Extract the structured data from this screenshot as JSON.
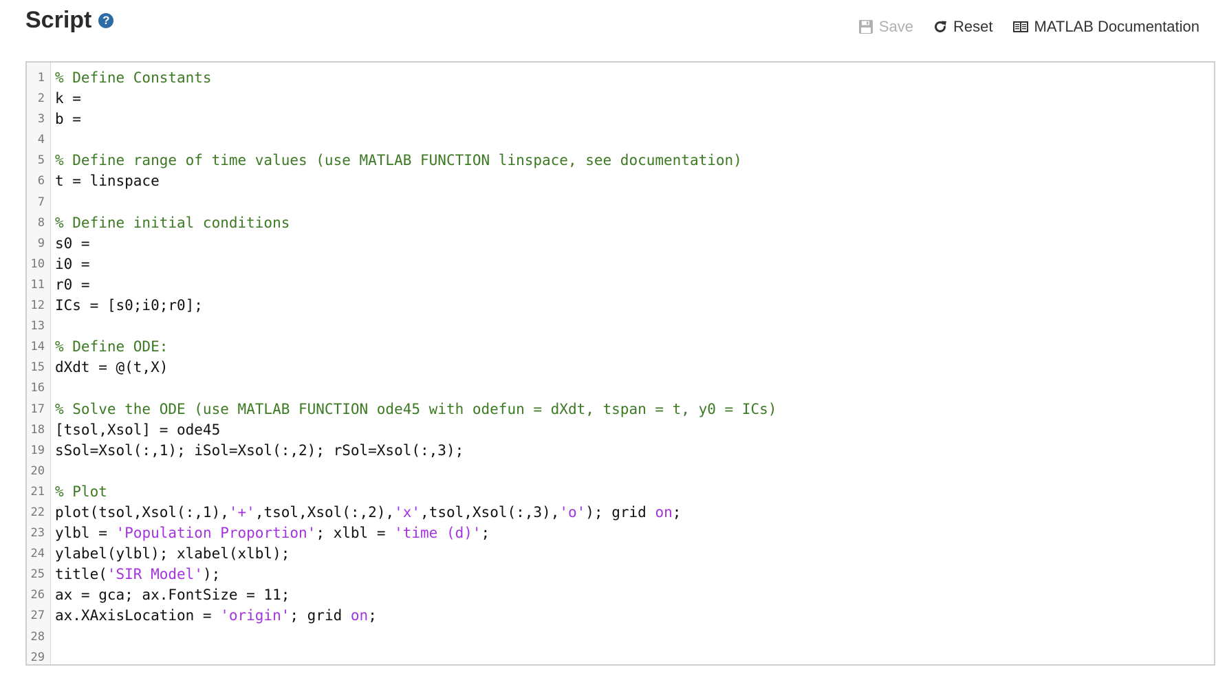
{
  "header": {
    "title": "Script",
    "help_glyph": "?",
    "save_label": "Save",
    "reset_label": "Reset",
    "docs_label": "MATLAB Documentation"
  },
  "colors": {
    "comment": "#3b7a22",
    "string": "#a433e0",
    "help_icon_bg": "#2d6ba6",
    "disabled": "#b0b0b0"
  },
  "icons": [
    "help-icon",
    "save-icon",
    "reset-icon",
    "book-icon"
  ],
  "editor": {
    "lines": [
      [
        {
          "t": "% Define Constants",
          "c": "cmt"
        }
      ],
      [
        {
          "t": "k = ",
          "c": ""
        }
      ],
      [
        {
          "t": "b = ",
          "c": ""
        }
      ],
      [],
      [
        {
          "t": "% Define range of time values (use MATLAB FUNCTION linspace, see documentation)",
          "c": "cmt"
        }
      ],
      [
        {
          "t": "t = linspace",
          "c": ""
        }
      ],
      [],
      [
        {
          "t": "% Define initial conditions",
          "c": "cmt"
        }
      ],
      [
        {
          "t": "s0 = ",
          "c": ""
        }
      ],
      [
        {
          "t": "i0 = ",
          "c": ""
        }
      ],
      [
        {
          "t": "r0 = ",
          "c": ""
        }
      ],
      [
        {
          "t": "ICs = [s0;i0;r0];",
          "c": ""
        }
      ],
      [],
      [
        {
          "t": "% Define ODE:",
          "c": "cmt"
        }
      ],
      [
        {
          "t": "dXdt = @(t,X)",
          "c": ""
        }
      ],
      [],
      [
        {
          "t": "% Solve the ODE (use MATLAB FUNCTION ode45 with odefun = dXdt, tspan = t, y0 = ICs)",
          "c": "cmt"
        }
      ],
      [
        {
          "t": "[tsol,Xsol] = ode45",
          "c": ""
        }
      ],
      [
        {
          "t": "sSol=Xsol(:,1); iSol=Xsol(:,2); rSol=Xsol(:,3);",
          "c": ""
        }
      ],
      [],
      [
        {
          "t": "% Plot",
          "c": "cmt"
        }
      ],
      [
        {
          "t": "plot(tsol,Xsol(:,1),",
          "c": ""
        },
        {
          "t": "'+'",
          "c": "str"
        },
        {
          "t": ",tsol,Xsol(:,2),",
          "c": ""
        },
        {
          "t": "'x'",
          "c": "str"
        },
        {
          "t": ",tsol,Xsol(:,3),",
          "c": ""
        },
        {
          "t": "'o'",
          "c": "str"
        },
        {
          "t": "); grid ",
          "c": ""
        },
        {
          "t": "on",
          "c": "kw"
        },
        {
          "t": ";",
          "c": ""
        }
      ],
      [
        {
          "t": "ylbl = ",
          "c": ""
        },
        {
          "t": "'Population Proportion'",
          "c": "str"
        },
        {
          "t": "; xlbl = ",
          "c": ""
        },
        {
          "t": "'time (d)'",
          "c": "str"
        },
        {
          "t": ";",
          "c": ""
        }
      ],
      [
        {
          "t": "ylabel(ylbl); xlabel(xlbl);",
          "c": ""
        }
      ],
      [
        {
          "t": "title(",
          "c": ""
        },
        {
          "t": "'SIR Model'",
          "c": "str"
        },
        {
          "t": ");",
          "c": ""
        }
      ],
      [
        {
          "t": "ax = gca; ax.FontSize = 11;",
          "c": ""
        }
      ],
      [
        {
          "t": "ax.XAxisLocation = ",
          "c": ""
        },
        {
          "t": "'origin'",
          "c": "str"
        },
        {
          "t": "; grid ",
          "c": ""
        },
        {
          "t": "on",
          "c": "kw"
        },
        {
          "t": ";",
          "c": ""
        }
      ],
      [],
      []
    ]
  }
}
